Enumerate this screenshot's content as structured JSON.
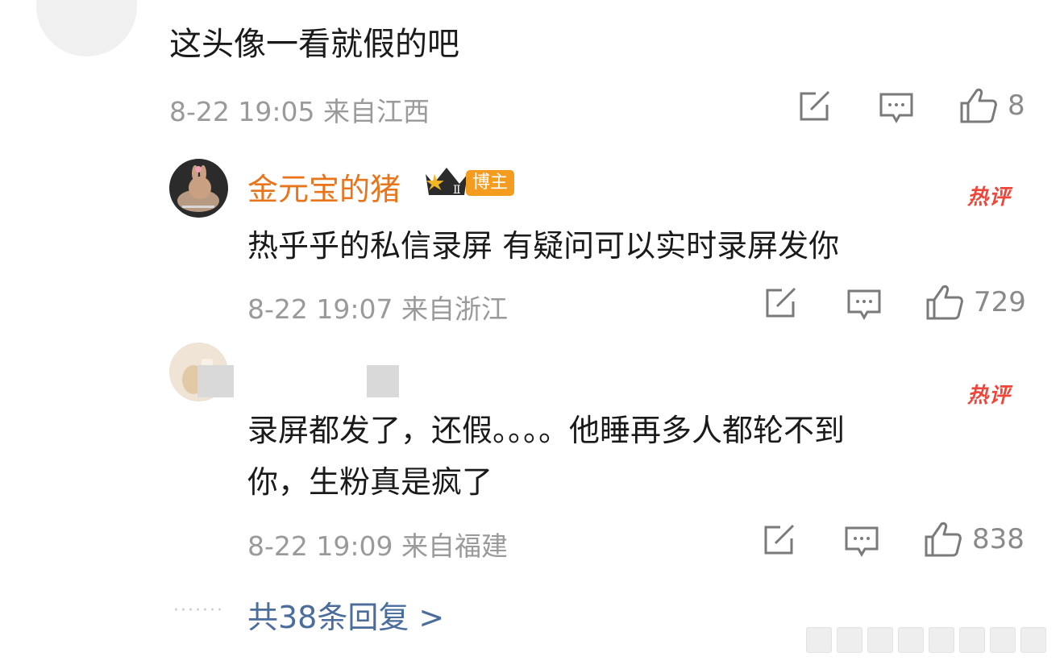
{
  "comments": [
    {
      "text": "这头像一看就假的吧",
      "meta": "8-22 19:05 来自江西",
      "likes": "8"
    },
    {
      "username": "金元宝的猪",
      "badge_level": "Ⅱ",
      "role_tag": "博主",
      "hot_label": "热评",
      "text": "热乎乎的私信录屏 有疑问可以实时录屏发你",
      "meta": "8-22 19:07 来自浙江",
      "likes": "729"
    },
    {
      "hot_label": "热评",
      "text_line1": "录屏都发了，还假。。。。他睡再多人都轮不到",
      "text_line2": "你，生粉真是疯了",
      "meta": "8-22 19:09 来自福建",
      "likes": "838"
    }
  ],
  "replies": {
    "dots": "·······",
    "label": "共38条回复 >"
  }
}
